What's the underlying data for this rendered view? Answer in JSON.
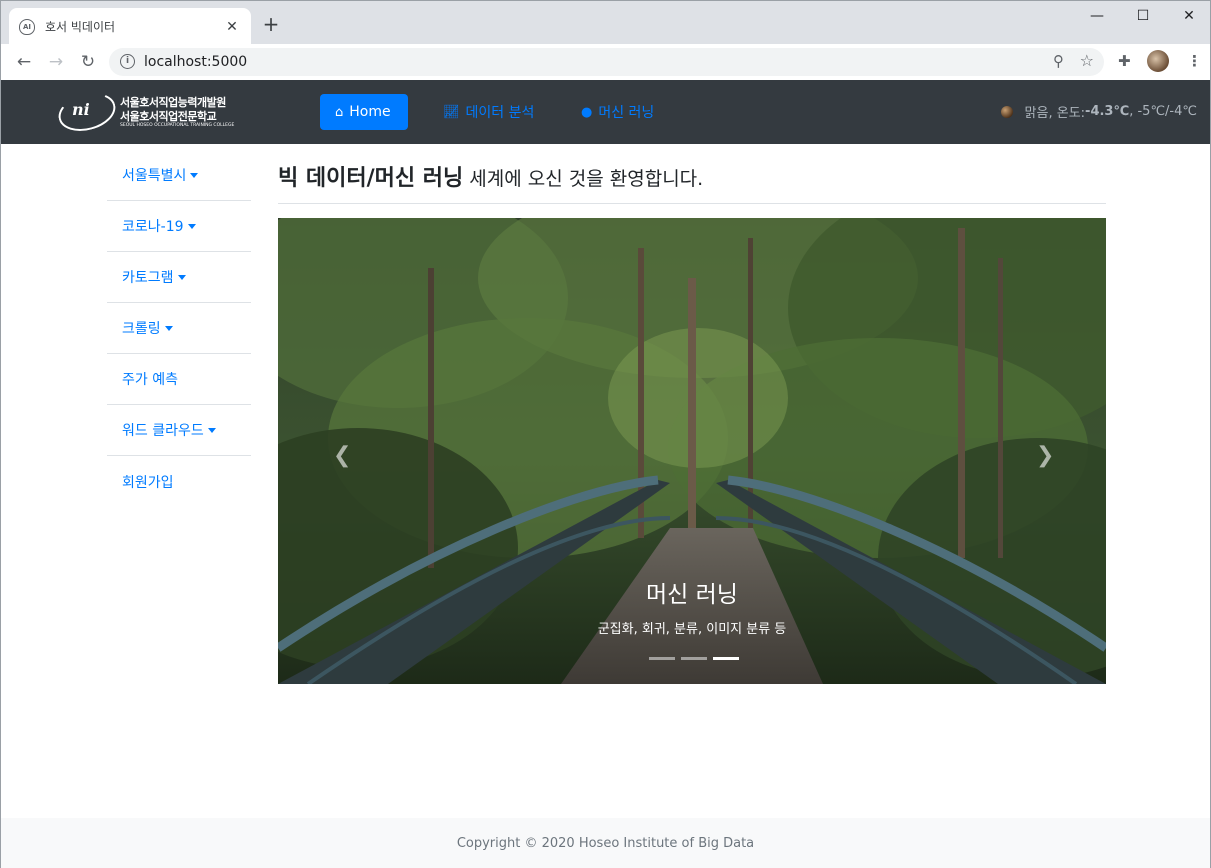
{
  "browser": {
    "tab_title": "호서 빅데이터",
    "tab_close": "✕",
    "new_tab": "+",
    "url": "localhost:5000",
    "window_controls": {
      "minimize": "—",
      "maximize": "☐",
      "close": "✕"
    }
  },
  "navbar": {
    "logo": {
      "mark_text": "ni",
      "line1": "서울호서직업능력개발원",
      "line2": "서울호서직업전문학교",
      "line3": "SEOUL HOSEO OCCUPATIONAL TRAINING COLLEGE"
    },
    "links": [
      {
        "label": "Home",
        "icon": "home-icon",
        "active": true
      },
      {
        "label": "데이터 분석",
        "icon": "chart-line-icon",
        "active": false
      },
      {
        "label": "머신 러닝",
        "icon": "brain-icon",
        "active": false
      }
    ],
    "weather": {
      "condition": "맑음, 온도: ",
      "temp": "-4.3℃",
      "range": ", -5℃/-4℃"
    }
  },
  "sidebar": {
    "items": [
      {
        "label": "서울특별시",
        "dropdown": true
      },
      {
        "label": "코로나-19",
        "dropdown": true
      },
      {
        "label": "카토그램",
        "dropdown": true
      },
      {
        "label": "크롤링",
        "dropdown": true
      },
      {
        "label": "주가 예측",
        "dropdown": false
      },
      {
        "label": "워드 클라우드",
        "dropdown": true
      },
      {
        "label": "회원가입",
        "dropdown": false
      }
    ]
  },
  "main": {
    "heading_strong": "빅 데이터/머신 러닝",
    "heading_rest": "세계에 오신 것을 환영합니다."
  },
  "carousel": {
    "caption_title": "머신 러닝",
    "caption_text": "군집화, 회귀, 분류, 이미지 분류 등",
    "prev": "❮",
    "next": "❯",
    "active_index": 2,
    "slide_count": 3
  },
  "footer": {
    "text": "Copyright © 2020 Hoseo Institute of Big Data"
  }
}
